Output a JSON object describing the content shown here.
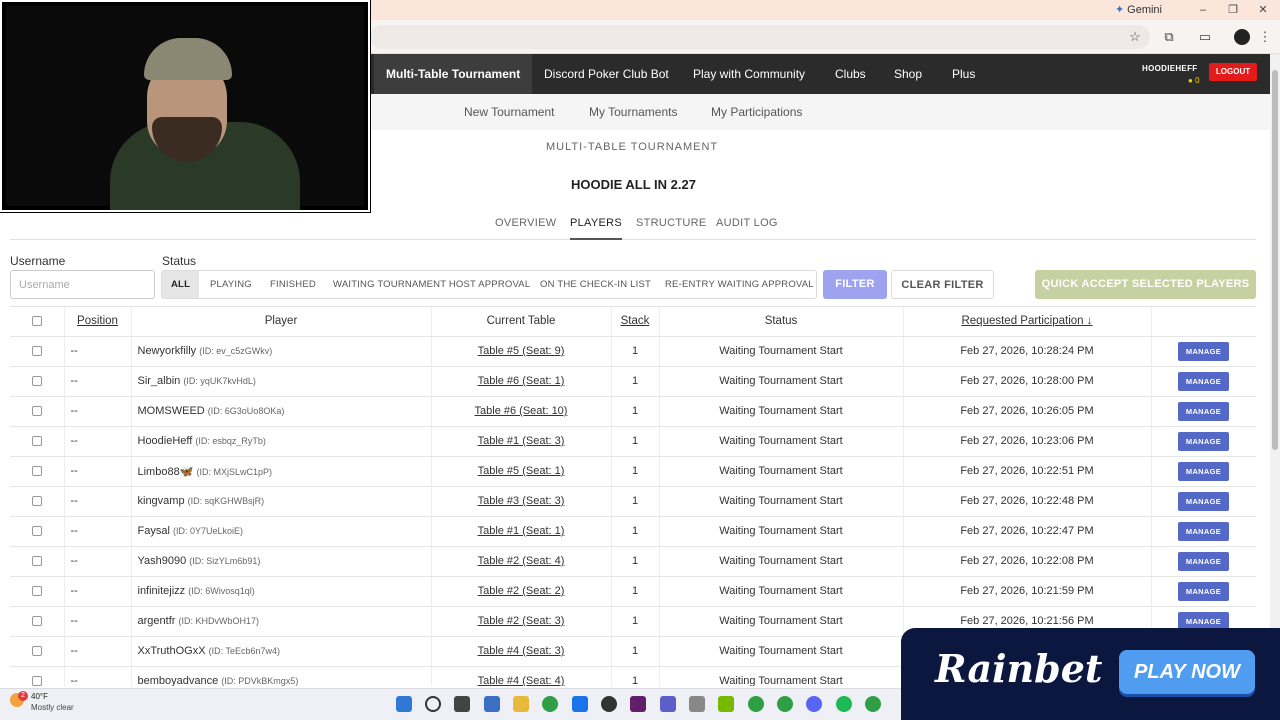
{
  "browser": {
    "gemini_label": "Gemini",
    "controls": [
      "–",
      "❐",
      "✕"
    ]
  },
  "nav": {
    "items": [
      "Multi-Table Tournament",
      "Discord Poker Club Bot",
      "Play with Community",
      "Clubs",
      "Shop",
      "Plus"
    ],
    "username": "HOODIEHEFF",
    "coins": "0",
    "logout": "LOGOUT"
  },
  "subnav": {
    "items": [
      "New Tournament",
      "My Tournaments",
      "My Participations"
    ]
  },
  "page": {
    "section_label": "MULTI-TABLE TOURNAMENT",
    "tournament_title": "HOODIE ALL IN 2.27"
  },
  "tabs": [
    "OVERVIEW",
    "PLAYERS",
    "STRUCTURE",
    "AUDIT LOG"
  ],
  "filters": {
    "username_label": "Username",
    "username_placeholder": "Username",
    "status_label": "Status",
    "statuses": [
      "ALL",
      "PLAYING",
      "FINISHED",
      "WAITING TOURNAMENT HOST APPROVAL",
      "ON THE CHECK-IN LIST",
      "RE-ENTRY WAITING APPROVAL"
    ],
    "filter_button": "FILTER",
    "clear_button": "CLEAR FILTER",
    "quick_accept_button": "QUICK ACCEPT SELECTED PLAYERS"
  },
  "table": {
    "headers": [
      "Position",
      "Player",
      "Current Table",
      "Stack",
      "Status",
      "Requested Participation ↓"
    ],
    "manage_label": "MANAGE",
    "rows": [
      {
        "position": "--",
        "name": "Newyorkfilly",
        "id": "(ID: ev_c5zGWkv)",
        "table": "Table #5 (Seat: 9)",
        "stack": "1",
        "status": "Waiting Tournament Start",
        "requested": "Feb 27, 2026, 10:28:24 PM"
      },
      {
        "position": "--",
        "name": "Sir_albin",
        "id": "(ID: yqUK7kvHdL)",
        "table": "Table #6 (Seat: 1)",
        "stack": "1",
        "status": "Waiting Tournament Start",
        "requested": "Feb 27, 2026, 10:28:00 PM"
      },
      {
        "position": "--",
        "name": "MOMSWEED",
        "id": "(ID: 6G3oUo8OKa)",
        "table": "Table #6 (Seat: 10)",
        "stack": "1",
        "status": "Waiting Tournament Start",
        "requested": "Feb 27, 2026, 10:26:05 PM"
      },
      {
        "position": "--",
        "name": "HoodieHeff",
        "id": "(ID: esbqz_RyTb)",
        "table": "Table #1 (Seat: 3)",
        "stack": "1",
        "status": "Waiting Tournament Start",
        "requested": "Feb 27, 2026, 10:23:06 PM"
      },
      {
        "position": "--",
        "name": "Limbo88🦋",
        "id": "(ID: MXjSLwC1pP)",
        "table": "Table #5 (Seat: 1)",
        "stack": "1",
        "status": "Waiting Tournament Start",
        "requested": "Feb 27, 2026, 10:22:51 PM"
      },
      {
        "position": "--",
        "name": "kingvamp",
        "id": "(ID: sqKGHWBsjR)",
        "table": "Table #3 (Seat: 3)",
        "stack": "1",
        "status": "Waiting Tournament Start",
        "requested": "Feb 27, 2026, 10:22:48 PM"
      },
      {
        "position": "--",
        "name": "Faysal",
        "id": "(ID: 0Y7UeLkoiE)",
        "table": "Table #1 (Seat: 1)",
        "stack": "1",
        "status": "Waiting Tournament Start",
        "requested": "Feb 27, 2026, 10:22:47 PM"
      },
      {
        "position": "--",
        "name": "Yash9090",
        "id": "(ID: SizYLm6b91)",
        "table": "Table #2 (Seat: 4)",
        "stack": "1",
        "status": "Waiting Tournament Start",
        "requested": "Feb 27, 2026, 10:22:08 PM"
      },
      {
        "position": "--",
        "name": "infinitejizz",
        "id": "(ID: 6Wivosq1ql)",
        "table": "Table #2 (Seat: 2)",
        "stack": "1",
        "status": "Waiting Tournament Start",
        "requested": "Feb 27, 2026, 10:21:59 PM"
      },
      {
        "position": "--",
        "name": "argentfr",
        "id": "(ID: KHDvWbOH17)",
        "table": "Table #2 (Seat: 3)",
        "stack": "1",
        "status": "Waiting Tournament Start",
        "requested": "Feb 27, 2026, 10:21:56 PM"
      },
      {
        "position": "--",
        "name": "XxTruthOGxX",
        "id": "(ID: TeEcb6n7w4)",
        "table": "Table #4 (Seat: 3)",
        "stack": "1",
        "status": "Waiting Tournament Start",
        "requested": ""
      },
      {
        "position": "--",
        "name": "bemboyadvance",
        "id": "(ID: PDVkBKmgx5)",
        "table": "Table #4 (Seat: 4)",
        "stack": "1",
        "status": "Waiting Tournament Start",
        "requested": ""
      }
    ]
  },
  "ad": {
    "brand": "Rainbet",
    "cta": "PLAY NOW"
  },
  "taskbar": {
    "badge": "2",
    "temperature": "40°F",
    "condition": "Mostly clear"
  },
  "colors": {
    "nav_bg": "#2b2b2b",
    "logout": "#e31b1b",
    "manage": "#5468c8",
    "filter": "#9ea3f0",
    "quick_accept": "#c5d1a0",
    "ad_bg": "#0c1740",
    "cta": "#4f9cf0"
  }
}
